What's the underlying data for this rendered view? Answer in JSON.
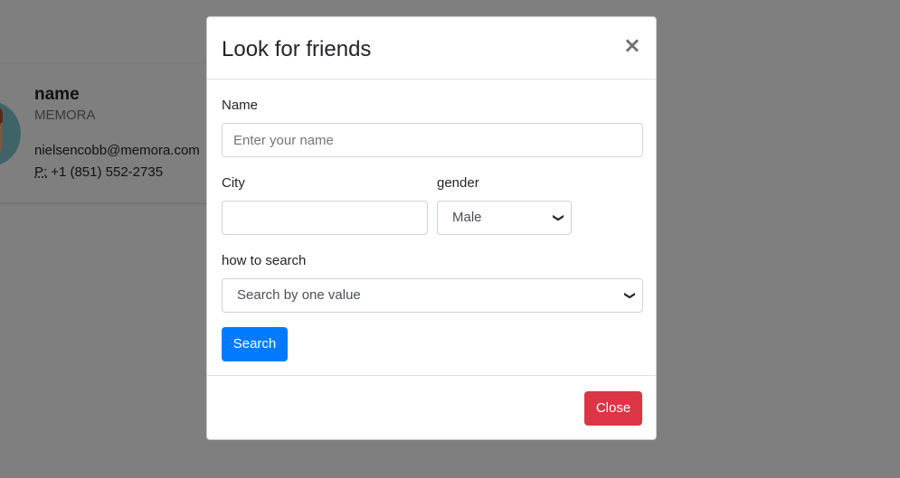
{
  "card": {
    "name": "name",
    "company": "MEMORA",
    "email": "nielsencobb@memora.com",
    "phone_abbr": "P:",
    "phone": "+1 (851) 552-2735"
  },
  "modal": {
    "title": "Look for friends",
    "close_icon": "×",
    "name_label": "Name",
    "name_placeholder": "Enter your name",
    "name_value": "",
    "city_label": "City",
    "city_value": "",
    "gender_label": "gender",
    "gender_selected": "Male",
    "how_label": "how to search",
    "how_selected": "Search by one value",
    "search_label": "Search",
    "close_label": "Close"
  },
  "colors": {
    "primary": "#007bff",
    "danger": "#dc3545",
    "backdrop": "rgba(0,0,0,0.5)"
  }
}
